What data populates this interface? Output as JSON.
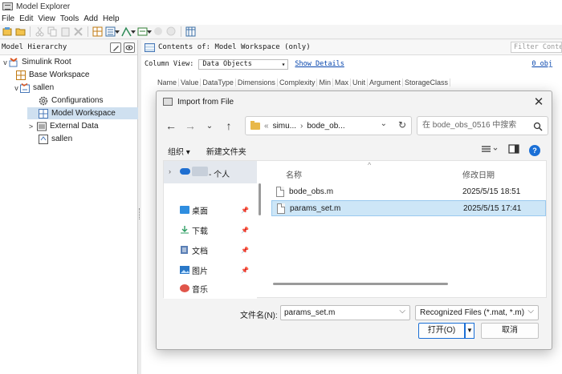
{
  "window": {
    "title": "Model Explorer"
  },
  "menu": [
    "File",
    "Edit",
    "View",
    "Tools",
    "Add",
    "Help"
  ],
  "left_pane": {
    "header": "Model Hierarchy",
    "tree": [
      {
        "label": "Simulink Root",
        "icon": "simulink-root-icon",
        "twisty": "v"
      },
      {
        "label": "Base Workspace",
        "icon": "workspace-icon",
        "twisty": ""
      },
      {
        "label": "sallen",
        "icon": "model-icon",
        "twisty": "v"
      },
      {
        "label": "Configurations",
        "icon": "gear-icon",
        "twisty": ""
      },
      {
        "label": "Model Workspace",
        "icon": "workspace-icon",
        "twisty": "",
        "selected": true
      },
      {
        "label": "External Data",
        "icon": "external-data-icon",
        "twisty": ">"
      },
      {
        "label": "sallen",
        "icon": "model-icon",
        "twisty": ""
      }
    ]
  },
  "right_pane": {
    "contents_label": "Contents of: Model Workspace (only)",
    "filter_placeholder": "Filter Contents",
    "column_view_label": "Column View:",
    "column_view_value": "Data Objects",
    "show_details": "Show Details",
    "objects_count": "0 obj",
    "columns": [
      "Name",
      "Value",
      "DataType",
      "Dimensions",
      "Complexity",
      "Min",
      "Max",
      "Unit",
      "Argument",
      "StorageClass"
    ]
  },
  "dialog": {
    "title": "Import from File",
    "close": "✕",
    "nav": {
      "back": "←",
      "forward": "→",
      "recent": "⌄",
      "up": "↑"
    },
    "address": {
      "prefix": "«",
      "crumb1": "simu...",
      "sep": "›",
      "crumb2": "bode_ob...",
      "dropdown": "⌄",
      "refresh": "↻"
    },
    "search_placeholder": "在 bode_obs_0516 中搜索",
    "organize": "组织 ▾",
    "new_folder": "新建文件夹",
    "nav_pane": {
      "top_label": "- 个人",
      "items": [
        {
          "label": "桌面",
          "icon": "desktop-icon",
          "color": "#2f8ee0"
        },
        {
          "label": "下载",
          "icon": "download-icon",
          "color": "#2e9e63"
        },
        {
          "label": "文档",
          "icon": "document-icon",
          "color": "#5a7fb5"
        },
        {
          "label": "图片",
          "icon": "pictures-icon",
          "color": "#2a78c8"
        },
        {
          "label": "音乐",
          "icon": "music-icon",
          "color": "#e0554a"
        }
      ]
    },
    "file_list": {
      "col_name": "名称",
      "col_date": "修改日期",
      "files": [
        {
          "name": "bode_obs.m",
          "date": "2025/5/15 18:51",
          "selected": false
        },
        {
          "name": "params_set.m",
          "date": "2025/5/15 17:41",
          "selected": true
        }
      ]
    },
    "filename_label": "文件名(N):",
    "filename_value": "params_set.m",
    "filter_value": "Recognized Files (*.mat, *.m)",
    "open_button": "打开(O)",
    "cancel_button": "取消"
  }
}
